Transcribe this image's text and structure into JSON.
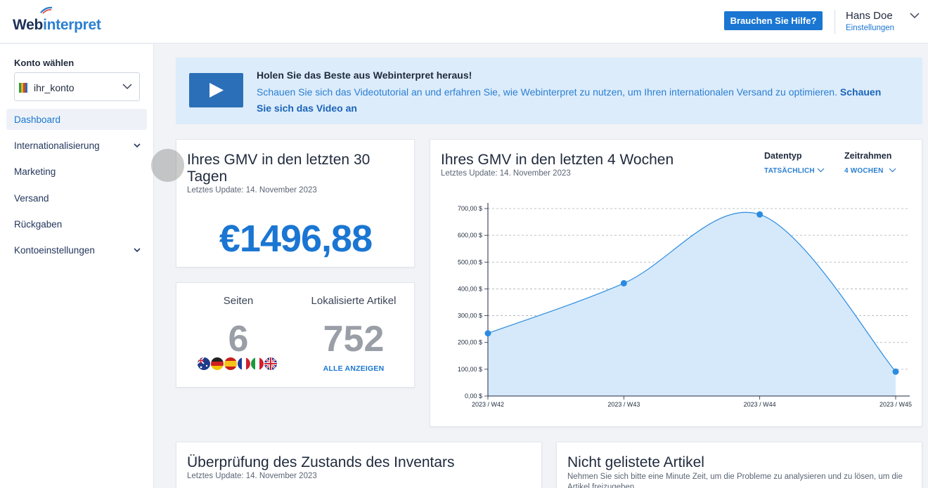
{
  "header": {
    "logo_part1": "Web",
    "logo_part2": "interpret",
    "help_button": "Brauchen Sie Hilfe?",
    "user_name": "Hans Doe",
    "user_settings": "Einstellungen"
  },
  "sidebar": {
    "account_label": "Konto wählen",
    "account_value": "ihr_konto",
    "items": [
      {
        "label": "Dashboard",
        "active": true,
        "expandable": false
      },
      {
        "label": "Internationalisierung",
        "active": false,
        "expandable": true
      },
      {
        "label": "Marketing",
        "active": false,
        "expandable": false
      },
      {
        "label": "Versand",
        "active": false,
        "expandable": false
      },
      {
        "label": "Rückgaben",
        "active": false,
        "expandable": false
      },
      {
        "label": "Kontoeinstellungen",
        "active": false,
        "expandable": true
      }
    ]
  },
  "banner": {
    "title": "Holen Sie das Beste aus Webinterpret heraus!",
    "text": "Schauen Sie sich das Videotutorial an und erfahren Sie, wie Webinterpret zu nutzen, um Ihren internationalen Versand zu optimieren. ",
    "link": "Schauen Sie sich das Video an"
  },
  "gmv30": {
    "title": "Ihres GMV in den letzten 30 Tagen",
    "updated": "Letztes Update: 14. November 2023",
    "value": "€1496,88"
  },
  "stats": {
    "sites_label": "Seiten",
    "sites_value": "6",
    "articles_label": "Lokalisierte Artikel",
    "articles_value": "752",
    "show_all": "ALLE ANZEIGEN",
    "flags": [
      "australia-flag",
      "germany-flag",
      "spain-flag",
      "france-flag",
      "italy-flag",
      "uk-flag"
    ]
  },
  "gmv4w": {
    "title": "Ihres GMV in den letzten 4 Wochen",
    "updated": "Letztes Update: 14. November 2023",
    "datatype_label": "Datentyp",
    "datatype_value": "TATSÄCHLICH",
    "timeframe_label": "Zeitrahmen",
    "timeframe_value": "4 WOCHEN"
  },
  "chart_data": {
    "type": "area",
    "categories": [
      "2023 / W42",
      "2023 / W43",
      "2023 / W44",
      "2023 / W45"
    ],
    "values": [
      234,
      421,
      678,
      91
    ],
    "y_tick_labels": [
      "0,00 $",
      "100,00 $",
      "200,00 $",
      "300,00 $",
      "400,00 $",
      "500,00 $",
      "600,00 $",
      "700,00 $"
    ],
    "y_ticks": [
      0,
      100,
      200,
      300,
      400,
      500,
      600,
      700
    ],
    "ylim": [
      0,
      700
    ],
    "grid": true,
    "color": "#2b8be0",
    "fill": "#d6e9fb"
  },
  "inventory": {
    "title": "Überprüfung des Zustands des Inventars",
    "updated": "Letztes Update: 14. November 2023"
  },
  "unlisted": {
    "title": "Nicht gelistete Artikel",
    "text": "Nehmen Sie sich bitte eine Minute Zeit, um die Probleme zu analysieren und zu lösen, um die Artikel freizugeben."
  }
}
